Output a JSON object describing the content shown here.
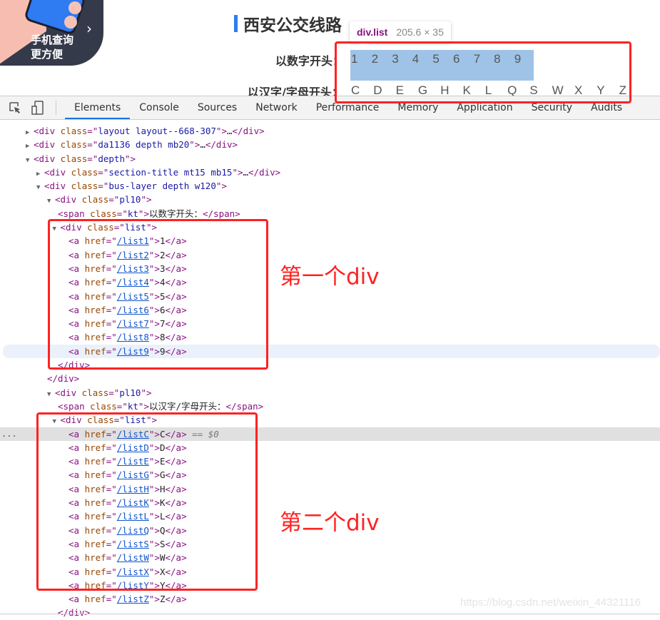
{
  "page": {
    "promo": {
      "line1": "手机查询",
      "line2": "更方便",
      "chevron": "›"
    },
    "title": "西安公交线路",
    "number_row": {
      "label": "以数字开头：",
      "items": [
        "1",
        "2",
        "3",
        "4",
        "5",
        "6",
        "7",
        "8",
        "9"
      ]
    },
    "letter_row": {
      "label": "以汉字/字母开头：",
      "items": [
        "C",
        "D",
        "E",
        "G",
        "H",
        "K",
        "L",
        "Q",
        "S",
        "W",
        "X",
        "Y",
        "Z"
      ]
    },
    "tooltip": {
      "tag": "div.list",
      "size": "205.6 × 35"
    },
    "colors": {
      "accent": "#2f7cf0",
      "highlight": "#9fc3e7",
      "annotation": "#ff2222"
    }
  },
  "devtools": {
    "tabs": [
      "Elements",
      "Console",
      "Sources",
      "Network",
      "Performance",
      "Memory",
      "Application",
      "Security",
      "Audits"
    ],
    "active_tab": "Elements",
    "icons": [
      "inspect-element-icon",
      "device-toolbar-icon"
    ],
    "selected_suffix": "== $0",
    "dom_lines": [
      {
        "indent": 0,
        "tri": "▶",
        "tag": "div",
        "attr": "class",
        "val": "layout layout--668-307",
        "collapsed": true
      },
      {
        "indent": 0,
        "tri": "▶",
        "tag": "div",
        "attr": "class",
        "val": "da1136 depth mb20",
        "collapsed": true
      },
      {
        "indent": 0,
        "tri": "▼",
        "tag": "div",
        "attr": "class",
        "val": "depth"
      },
      {
        "indent": 1,
        "tri": "▶",
        "tag": "div",
        "attr": "class",
        "val": "section-title mt15 mb15",
        "collapsed": true
      },
      {
        "indent": 1,
        "tri": "▼",
        "tag": "div",
        "attr": "class",
        "val": "bus-layer depth w120"
      },
      {
        "indent": 2,
        "tri": "▼",
        "tag": "div",
        "attr": "class",
        "val": "pl10"
      },
      {
        "indent": 3,
        "tag": "span",
        "attr": "class",
        "val": "kt",
        "text": "以数字开头：",
        "close": "span"
      },
      {
        "indent": 2.5,
        "tri": "▼",
        "tag": "div",
        "attr": "class",
        "val": "list"
      },
      {
        "indent": 4,
        "tag": "a",
        "attr": "href",
        "val": "/list1",
        "link": true,
        "text": "1",
        "close": "a"
      },
      {
        "indent": 4,
        "tag": "a",
        "attr": "href",
        "val": "/list2",
        "link": true,
        "text": "2",
        "close": "a"
      },
      {
        "indent": 4,
        "tag": "a",
        "attr": "href",
        "val": "/list3",
        "link": true,
        "text": "3",
        "close": "a"
      },
      {
        "indent": 4,
        "tag": "a",
        "attr": "href",
        "val": "/list4",
        "link": true,
        "text": "4",
        "close": "a"
      },
      {
        "indent": 4,
        "tag": "a",
        "attr": "href",
        "val": "/list5",
        "link": true,
        "text": "5",
        "close": "a"
      },
      {
        "indent": 4,
        "tag": "a",
        "attr": "href",
        "val": "/list6",
        "link": true,
        "text": "6",
        "close": "a"
      },
      {
        "indent": 4,
        "tag": "a",
        "attr": "href",
        "val": "/list7",
        "link": true,
        "text": "7",
        "close": "a"
      },
      {
        "indent": 4,
        "tag": "a",
        "attr": "href",
        "val": "/list8",
        "link": true,
        "text": "8",
        "close": "a"
      },
      {
        "indent": 4,
        "tag": "a",
        "attr": "href",
        "val": "/list9",
        "link": true,
        "text": "9",
        "close": "a",
        "hover": true
      },
      {
        "indent": 3,
        "closeonly": "div"
      },
      {
        "indent": 2,
        "closeonly": "div"
      },
      {
        "indent": 2,
        "tri": "▼",
        "tag": "div",
        "attr": "class",
        "val": "pl10"
      },
      {
        "indent": 3,
        "tag": "span",
        "attr": "class",
        "val": "kt",
        "text": "以汉字/字母开头：",
        "close": "span"
      },
      {
        "indent": 2.5,
        "tri": "▼",
        "tag": "div",
        "attr": "class",
        "val": "list"
      },
      {
        "indent": 4,
        "tag": "a",
        "attr": "href",
        "val": "/listC",
        "link": true,
        "text": "C",
        "close": "a",
        "selected": true
      },
      {
        "indent": 4,
        "tag": "a",
        "attr": "href",
        "val": "/listD",
        "link": true,
        "text": "D",
        "close": "a"
      },
      {
        "indent": 4,
        "tag": "a",
        "attr": "href",
        "val": "/listE",
        "link": true,
        "text": "E",
        "close": "a"
      },
      {
        "indent": 4,
        "tag": "a",
        "attr": "href",
        "val": "/listG",
        "link": true,
        "text": "G",
        "close": "a"
      },
      {
        "indent": 4,
        "tag": "a",
        "attr": "href",
        "val": "/listH",
        "link": true,
        "text": "H",
        "close": "a"
      },
      {
        "indent": 4,
        "tag": "a",
        "attr": "href",
        "val": "/listK",
        "link": true,
        "text": "K",
        "close": "a"
      },
      {
        "indent": 4,
        "tag": "a",
        "attr": "href",
        "val": "/listL",
        "link": true,
        "text": "L",
        "close": "a"
      },
      {
        "indent": 4,
        "tag": "a",
        "attr": "href",
        "val": "/listQ",
        "link": true,
        "text": "Q",
        "close": "a"
      },
      {
        "indent": 4,
        "tag": "a",
        "attr": "href",
        "val": "/listS",
        "link": true,
        "text": "S",
        "close": "a"
      },
      {
        "indent": 4,
        "tag": "a",
        "attr": "href",
        "val": "/listW",
        "link": true,
        "text": "W",
        "close": "a"
      },
      {
        "indent": 4,
        "tag": "a",
        "attr": "href",
        "val": "/listX",
        "link": true,
        "text": "X",
        "close": "a"
      },
      {
        "indent": 4,
        "tag": "a",
        "attr": "href",
        "val": "/listY",
        "link": true,
        "text": "Y",
        "close": "a"
      },
      {
        "indent": 4,
        "tag": "a",
        "attr": "href",
        "val": "/listZ",
        "link": true,
        "text": "Z",
        "close": "a"
      },
      {
        "indent": 3,
        "closeonly": "div"
      }
    ]
  },
  "annotations": {
    "first": "第一个div",
    "second": "第二个div"
  },
  "watermark": "https://blog.csdn.net/weixin_44321116"
}
